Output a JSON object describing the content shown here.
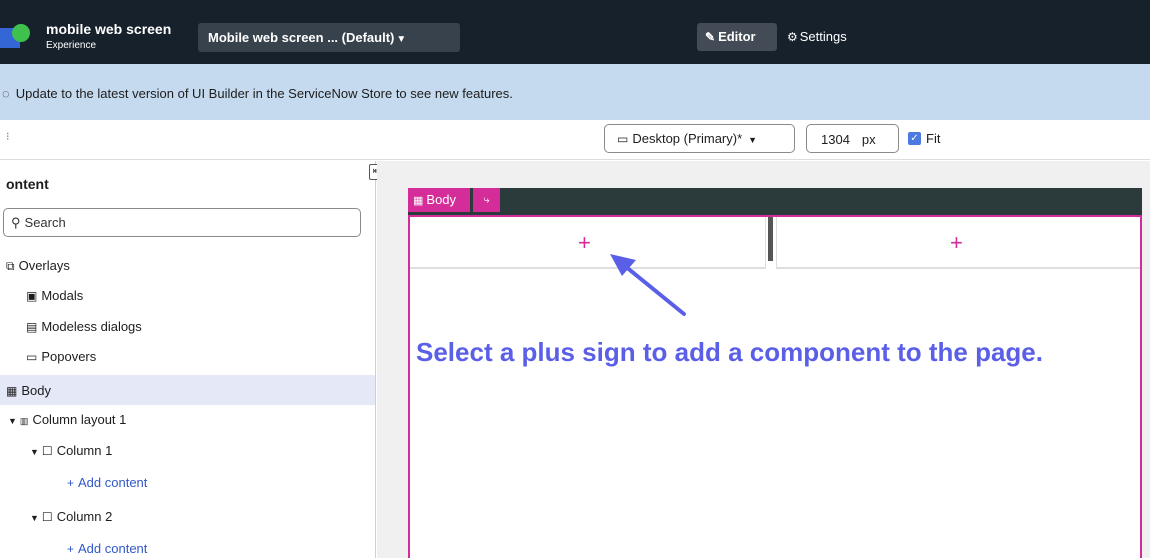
{
  "header": {
    "app_title": "mobile web screen",
    "app_subtitle": "Experience",
    "variant_label": "Mobile web screen ... (Default)",
    "editor_label": "Editor",
    "settings_label": "Settings"
  },
  "banner": {
    "message": "Update to the latest version of UI Builder in the ServiceNow Store to see new features."
  },
  "toolbar": {
    "device_label": "Desktop (Primary)*",
    "width_value": "1304",
    "width_unit": "px",
    "fit_label": "Fit",
    "fit_checked": true
  },
  "sidebar": {
    "heading": "ontent",
    "search_placeholder": "Search",
    "tree": {
      "overlays": "Overlays",
      "modals": "Modals",
      "modeless": "Modeless dialogs",
      "popovers": "Popovers",
      "body": "Body",
      "column_layout": "Column layout 1",
      "column1": "Column 1",
      "add_content_1": "Add content",
      "column2": "Column 2",
      "add_content_2": "Add content"
    }
  },
  "canvas": {
    "body_tag": "Body",
    "plus_1": "+",
    "plus_2": "+",
    "instruction": "Select a plus sign to add a component to the page."
  },
  "colors": {
    "topbar": "#16212b",
    "banner": "#c5daef",
    "accent_pink": "#d42c98",
    "instruction_blue": "#5b5fe8",
    "link_blue": "#3158c9"
  }
}
